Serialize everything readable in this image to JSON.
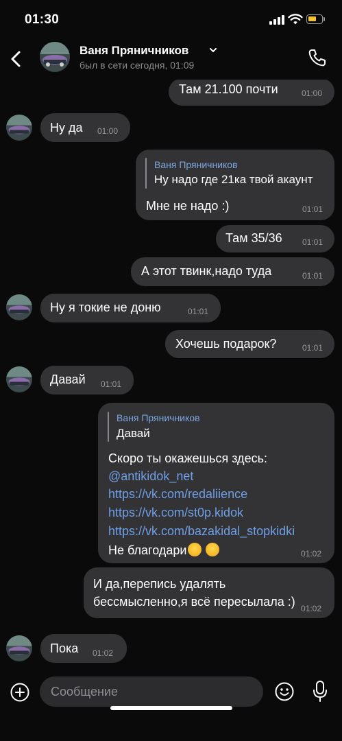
{
  "status_bar": {
    "time": "01:30",
    "battery_color": "#f4c430",
    "icons": [
      "signal-icon",
      "wifi-icon",
      "battery-charging-icon"
    ]
  },
  "header": {
    "name": "Ваня Пряничников",
    "status": "был в сети сегодня, 01:09",
    "icons": [
      "back-icon",
      "chevron-down-icon",
      "phone-icon"
    ]
  },
  "messages": [
    {
      "dir": "out",
      "text": "Там 21.100 почти",
      "time": "01:00"
    },
    {
      "dir": "in",
      "text": "Ну да",
      "time": "01:00"
    },
    {
      "dir": "out",
      "reply_name": "Ваня Пряничников",
      "reply_text": "Ну надо где 21ка твой акаунт",
      "text": "Мне не надо :)",
      "time": "01:01"
    },
    {
      "dir": "out",
      "text": "Там 35/36",
      "time": "01:01"
    },
    {
      "dir": "out",
      "text": "А этот твинк,надо туда",
      "time": "01:01"
    },
    {
      "dir": "in",
      "text": "Ну я токие не доню",
      "time": "01:01"
    },
    {
      "dir": "out",
      "text": "Хочешь подарок?",
      "time": "01:01"
    },
    {
      "dir": "in",
      "text": "Давай",
      "time": "01:01"
    },
    {
      "dir": "out",
      "reply_name": "Ваня Пряничников",
      "reply_text": "Давай",
      "lines": [
        "Скоро ты окажешься здесь:",
        "@antikidok_net",
        "https://vk.com/redaliience",
        "https://vk.com/st0p.kidok",
        "https://vk.com/bazakidal_stopkidki",
        "Не благодари"
      ],
      "time": "01:02"
    },
    {
      "dir": "out",
      "lines": [
        "И да,перепись удалять",
        "бессмысленно,я всё пересылала :)"
      ],
      "time": "01:02"
    },
    {
      "dir": "in",
      "text": "Пока",
      "time": "01:02"
    }
  ],
  "input": {
    "placeholder": "Сообщение",
    "icons": [
      "plus-icon",
      "smile-icon",
      "microphone-icon"
    ]
  },
  "colors": {
    "bubble": "#333335",
    "link": "#6f9fe6",
    "reply_name": "#7da6e0",
    "background": "#0a0a0a"
  }
}
